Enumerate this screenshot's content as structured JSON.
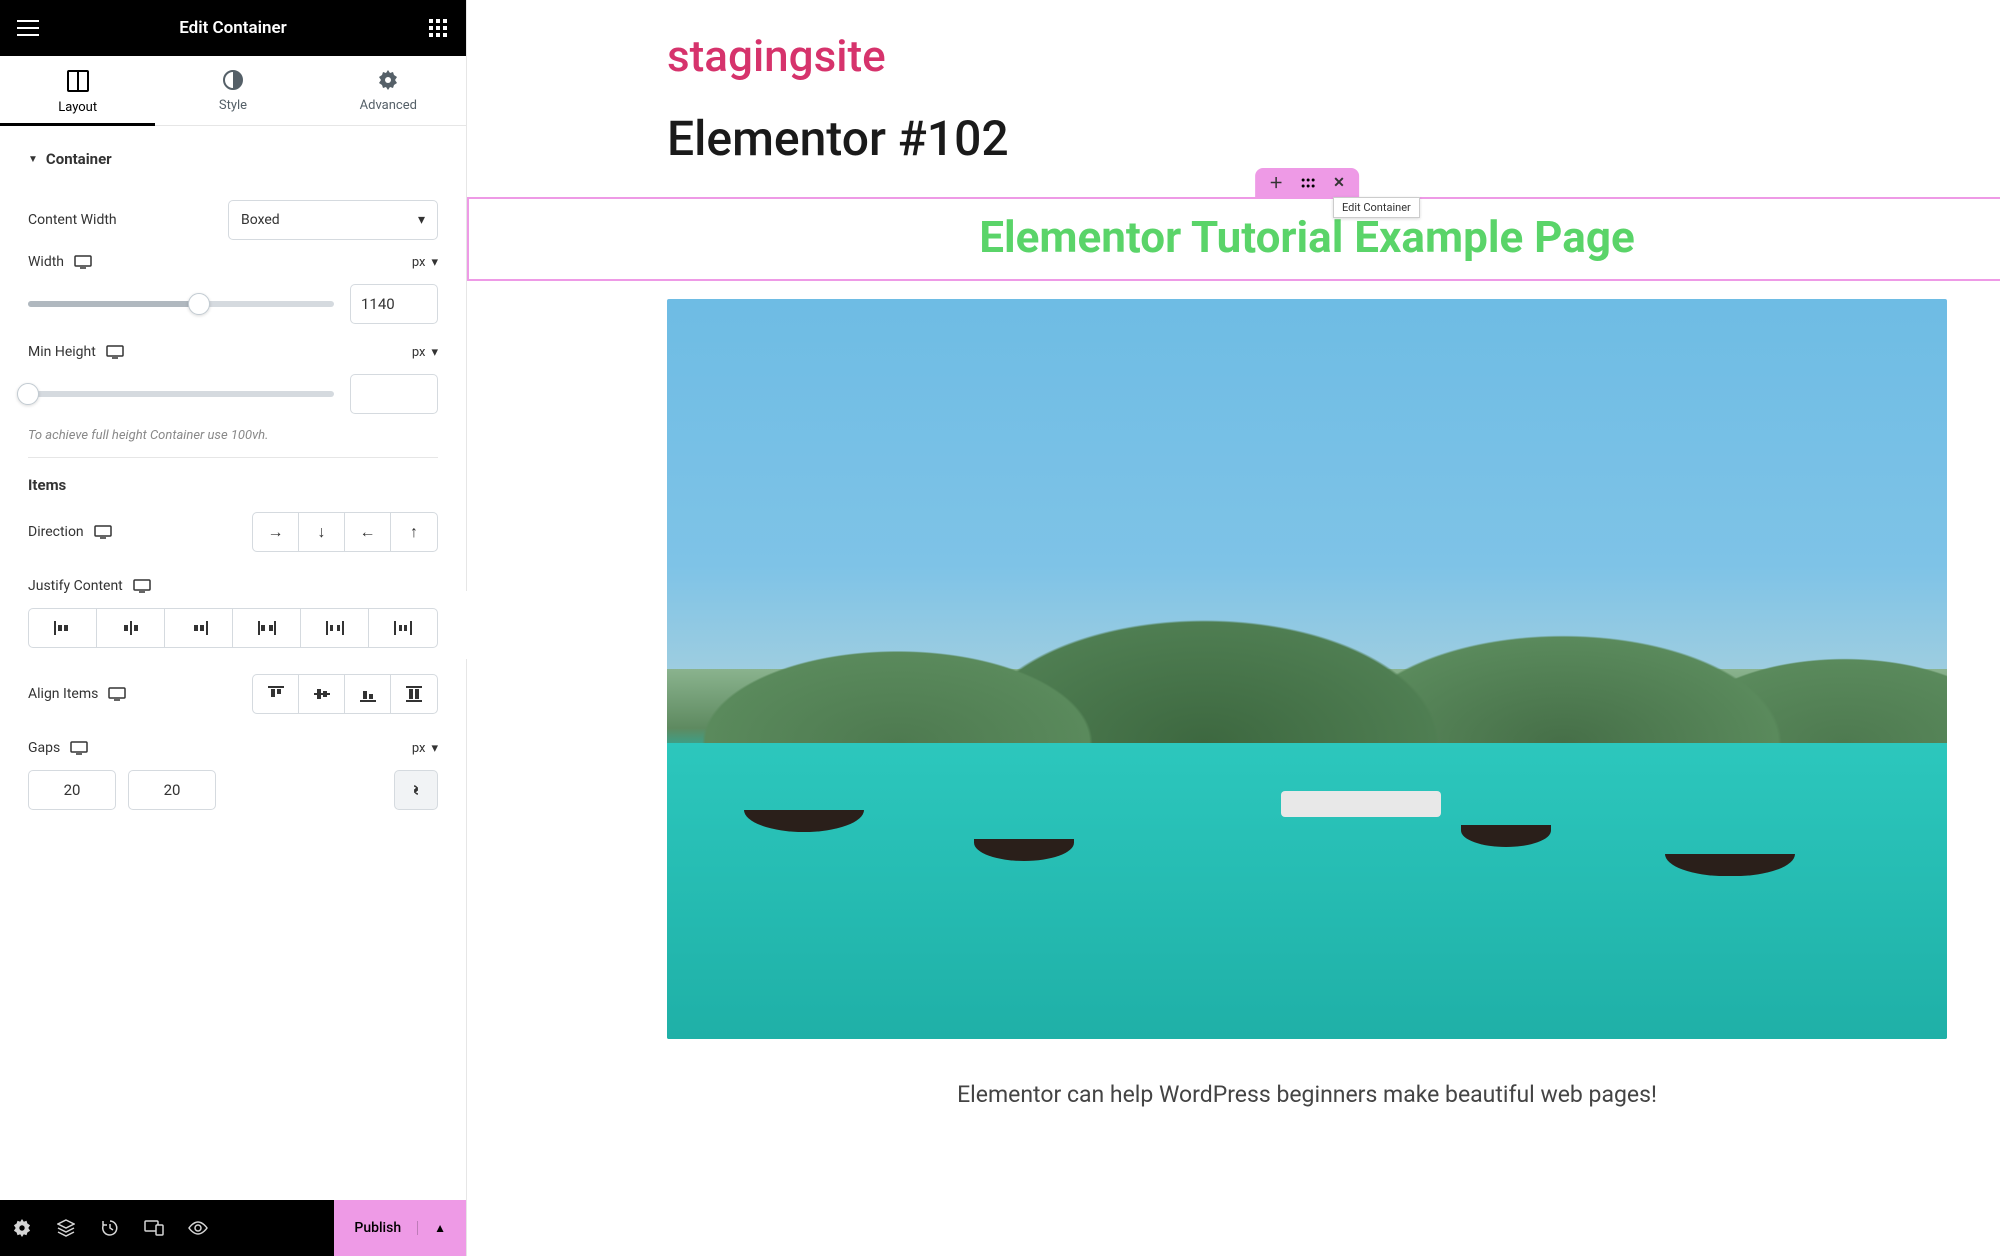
{
  "panel": {
    "title": "Edit Container",
    "tabs": {
      "layout": "Layout",
      "style": "Style",
      "advanced": "Advanced"
    },
    "section": "Container",
    "content_width_label": "Content Width",
    "content_width_value": "Boxed",
    "width_label": "Width",
    "width_unit": "px",
    "width_value": "1140",
    "min_height_label": "Min Height",
    "min_height_unit": "px",
    "min_height_value": "",
    "hint": "To achieve full height Container use 100vh.",
    "items_label": "Items",
    "direction_label": "Direction",
    "justify_label": "Justify Content",
    "align_label": "Align Items",
    "gaps_label": "Gaps",
    "gaps_unit": "px",
    "gap_col": "20",
    "gap_row": "20"
  },
  "bottombar": {
    "publish": "Publish"
  },
  "canvas": {
    "site_title": "stagingsite",
    "page_title": "Elementor #102",
    "heading": "Elementor Tutorial Example Page",
    "tooltip": "Edit Container",
    "caption": "Elementor can help WordPress beginners make beautiful web pages!"
  }
}
